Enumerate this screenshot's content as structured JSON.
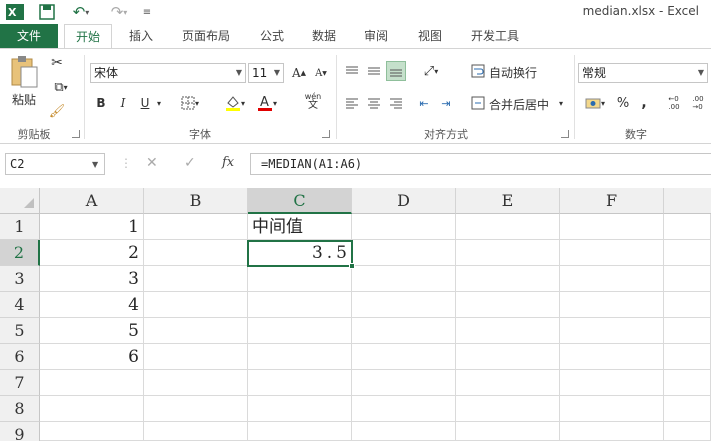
{
  "window": {
    "title": "median.xlsx - Excel"
  },
  "tabs": [
    "文件",
    "开始",
    "插入",
    "页面布局",
    "公式",
    "数据",
    "审阅",
    "视图",
    "开发工具"
  ],
  "ribbon": {
    "clipboard": {
      "paste_label": "粘贴",
      "group_label": "剪贴板"
    },
    "font": {
      "font_name": "宋体",
      "font_size": "11",
      "bold": "B",
      "italic": "I",
      "underline": "U",
      "group_label": "字体"
    },
    "alignment": {
      "wrap_text": "自动换行",
      "merge_center": "合并后居中",
      "group_label": "对齐方式"
    },
    "number": {
      "format": "常规",
      "percent": "%",
      "comma": ",",
      "group_label": "数字"
    }
  },
  "formula_bar": {
    "name_box": "C2",
    "fx": "fx",
    "formula": "=MEDIAN(A1:A6)"
  },
  "columns": [
    "A",
    "B",
    "C",
    "D",
    "E",
    "F"
  ],
  "rows": [
    "1",
    "2",
    "3",
    "4",
    "5",
    "6",
    "7",
    "8",
    "9"
  ],
  "cells": {
    "A1": "1",
    "A2": "2",
    "A3": "3",
    "A4": "4",
    "A5": "5",
    "A6": "6",
    "C1": "中间值",
    "C2": "3.5"
  },
  "colors": {
    "accent": "#217346"
  }
}
